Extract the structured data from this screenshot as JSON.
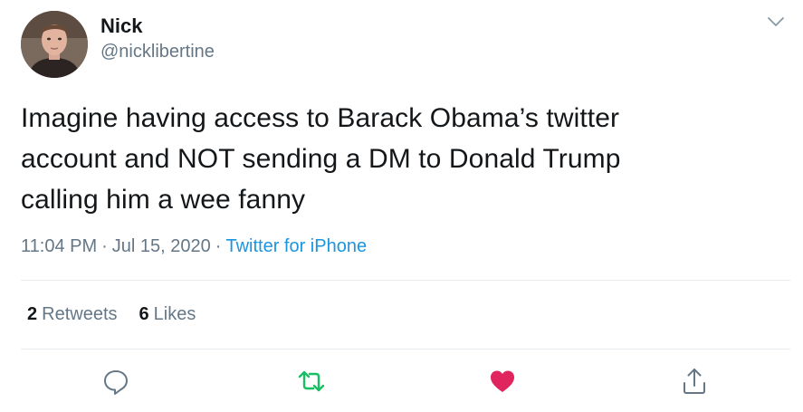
{
  "user": {
    "name": "Nick",
    "handle": "@nicklibertine"
  },
  "tweet": {
    "lines": [
      "Imagine having access to Barack Obama’s twitter",
      "account and NOT sending a DM to Donald Trump",
      "calling him a wee fanny"
    ],
    "time": "11:04 PM",
    "date": "Jul 15, 2020",
    "source": "Twitter for iPhone"
  },
  "stats": {
    "retweets_count": "2",
    "retweets_label": "Retweets",
    "likes_count": "6",
    "likes_label": "Likes"
  },
  "actions": {
    "reply_icon": "reply-icon",
    "retweet_icon": "retweet-icon",
    "like_icon": "heart-icon",
    "share_icon": "share-icon",
    "liked": true
  },
  "colors": {
    "text": "#14171a",
    "secondary": "#657786",
    "link": "#1b95e0",
    "retweet_green": "#17bf63",
    "like_red": "#e0245e",
    "divider": "#e6ecf0"
  }
}
